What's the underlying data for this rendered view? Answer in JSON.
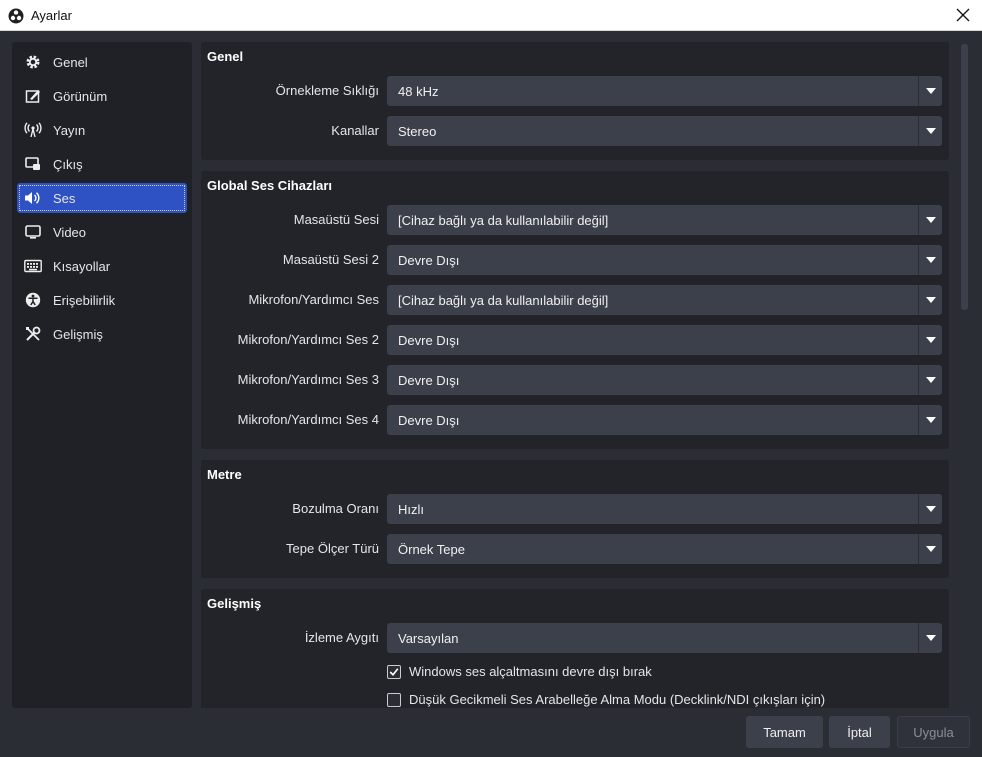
{
  "window": {
    "title": "Ayarlar",
    "accent": "#2e51c4"
  },
  "sidebar": {
    "items": [
      {
        "label": "Genel",
        "icon": "gear-icon"
      },
      {
        "label": "Görünüm",
        "icon": "palette-icon"
      },
      {
        "label": "Yayın",
        "icon": "broadcast-icon"
      },
      {
        "label": "Çıkış",
        "icon": "output-icon"
      },
      {
        "label": "Ses",
        "icon": "speaker-icon",
        "selected": true
      },
      {
        "label": "Video",
        "icon": "monitor-icon"
      },
      {
        "label": "Kısayollar",
        "icon": "keyboard-icon"
      },
      {
        "label": "Erişebilirlik",
        "icon": "accessibility-icon"
      },
      {
        "label": "Gelişmiş",
        "icon": "tools-icon"
      }
    ]
  },
  "groups": {
    "general": {
      "title": "Genel",
      "rows": [
        {
          "label": "Örnekleme Sıklığı",
          "value": "48 kHz"
        },
        {
          "label": "Kanallar",
          "value": "Stereo"
        }
      ]
    },
    "devices": {
      "title": "Global Ses Cihazları",
      "rows": [
        {
          "label": "Masaüstü Sesi",
          "value": "[Cihaz bağlı ya da kullanılabilir değil]"
        },
        {
          "label": "Masaüstü Sesi 2",
          "value": "Devre Dışı"
        },
        {
          "label": "Mikrofon/Yardımcı Ses",
          "value": "[Cihaz bağlı ya da kullanılabilir değil]"
        },
        {
          "label": "Mikrofon/Yardımcı Ses 2",
          "value": "Devre Dışı"
        },
        {
          "label": "Mikrofon/Yardımcı Ses 3",
          "value": "Devre Dışı"
        },
        {
          "label": "Mikrofon/Yardımcı Ses 4",
          "value": "Devre Dışı"
        }
      ]
    },
    "meters": {
      "title": "Metre",
      "rows": [
        {
          "label": "Bozulma Oranı",
          "value": "Hızlı"
        },
        {
          "label": "Tepe Ölçer Türü",
          "value": "Örnek Tepe"
        }
      ]
    },
    "advanced": {
      "title": "Gelişmiş",
      "rows": [
        {
          "label": "İzleme Aygıtı",
          "value": "Varsayılan"
        }
      ],
      "checks": [
        {
          "label": "Windows ses alçaltmasını devre dışı bırak",
          "checked": true
        },
        {
          "label": "Düşük Gecikmeli Ses Arabelleğe Alma Modu (Decklink/NDI çıkışları için)",
          "checked": false
        }
      ]
    }
  },
  "buttons": {
    "ok": "Tamam",
    "cancel": "İptal",
    "apply": "Uygula"
  }
}
